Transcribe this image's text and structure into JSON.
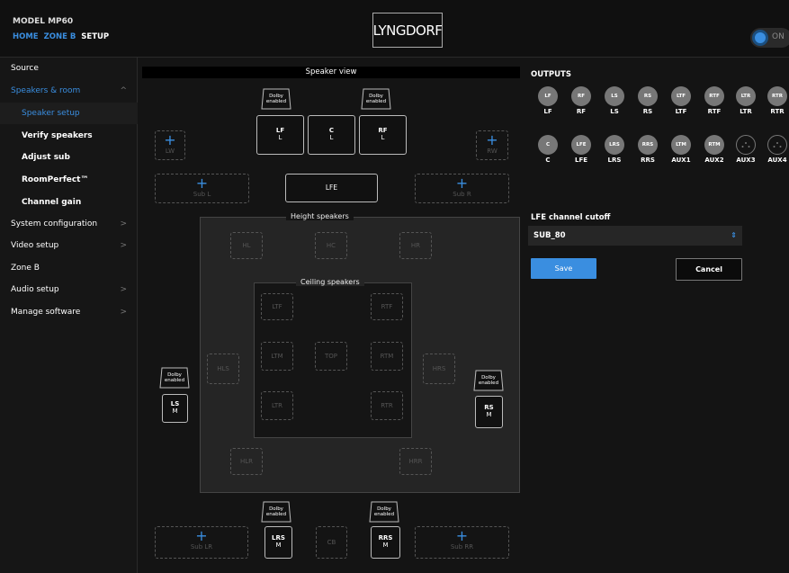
{
  "header": {
    "model": "MODEL MP60",
    "breadcrumb": [
      "HOME",
      "ZONE B",
      "SETUP"
    ],
    "logo": "LYNGDORF",
    "power_label": "ON"
  },
  "colors": {
    "accent": "#3a8ee0",
    "background": "#0f0f0f",
    "panel": "#252525"
  },
  "sidebar": {
    "items": [
      {
        "label": "Source"
      },
      {
        "label": "Speakers & room",
        "chevron": "^"
      },
      {
        "label": "Speaker setup"
      },
      {
        "label": "Verify speakers"
      },
      {
        "label": "Adjust sub"
      },
      {
        "label": "RoomPerfect™"
      },
      {
        "label": "Channel gain"
      },
      {
        "label": "System configuration",
        "chevron": ">"
      },
      {
        "label": "Video setup",
        "chevron": ">"
      },
      {
        "label": "Zone B"
      },
      {
        "label": "Audio setup",
        "chevron": ">"
      },
      {
        "label": "Manage software",
        "chevron": ">"
      }
    ]
  },
  "speaker_view": {
    "title": "Speaker view",
    "dolby": {
      "line1": "Dolby",
      "line2": "enabled"
    },
    "front": [
      {
        "name": "LF",
        "sub": "L"
      },
      {
        "name": "C",
        "sub": "L"
      },
      {
        "name": "RF",
        "sub": "L"
      }
    ],
    "lw": "LW",
    "rw": "RW",
    "sub_l": "Sub L",
    "sub_r": "Sub R",
    "lfe": "LFE",
    "height_title": "Height speakers",
    "height": {
      "hl": "HL",
      "hc": "HC",
      "hr": "HR",
      "hls": "HLS",
      "hrs": "HRS",
      "hlr": "HLR",
      "hrr": "HRR"
    },
    "ceiling_title": "Ceiling speakers",
    "ceiling": {
      "ltf": "LTF",
      "rtf": "RTF",
      "ltm": "LTM",
      "top": "TOP",
      "rtm": "RTM",
      "ltr": "LTR",
      "rtr": "RTR"
    },
    "ls": {
      "name": "LS",
      "sub": "M"
    },
    "rs": {
      "name": "RS",
      "sub": "M"
    },
    "lrs": {
      "name": "LRS",
      "sub": "M"
    },
    "rrs": {
      "name": "RRS",
      "sub": "M"
    },
    "cb": "CB",
    "sub_lr": "Sub LR",
    "sub_rr": "Sub RR"
  },
  "outputs": {
    "title": "OUTPUTS",
    "row1": [
      {
        "circle": "LF",
        "label": "LF"
      },
      {
        "circle": "RF",
        "label": "RF"
      },
      {
        "circle": "LS",
        "label": "LS"
      },
      {
        "circle": "RS",
        "label": "RS"
      },
      {
        "circle": "LTF",
        "label": "LTF"
      },
      {
        "circle": "RTF",
        "label": "RTF"
      },
      {
        "circle": "LTR",
        "label": "LTR"
      },
      {
        "circle": "RTR",
        "label": "RTR"
      }
    ],
    "row2": [
      {
        "circle": "C",
        "label": "C"
      },
      {
        "circle": "LFE",
        "label": "LFE"
      },
      {
        "circle": "LRS",
        "label": "LRS"
      },
      {
        "circle": "RRS",
        "label": "RRS"
      },
      {
        "circle": "LTM",
        "label": "AUX1"
      },
      {
        "circle": "RTM",
        "label": "AUX2"
      },
      {
        "circle": "",
        "label": "AUX3"
      },
      {
        "circle": "",
        "label": "AUX4"
      }
    ]
  },
  "lfe_cutoff": {
    "title": "LFE channel cutoff",
    "value": "SUB_80",
    "save": "Save",
    "cancel": "Cancel"
  }
}
